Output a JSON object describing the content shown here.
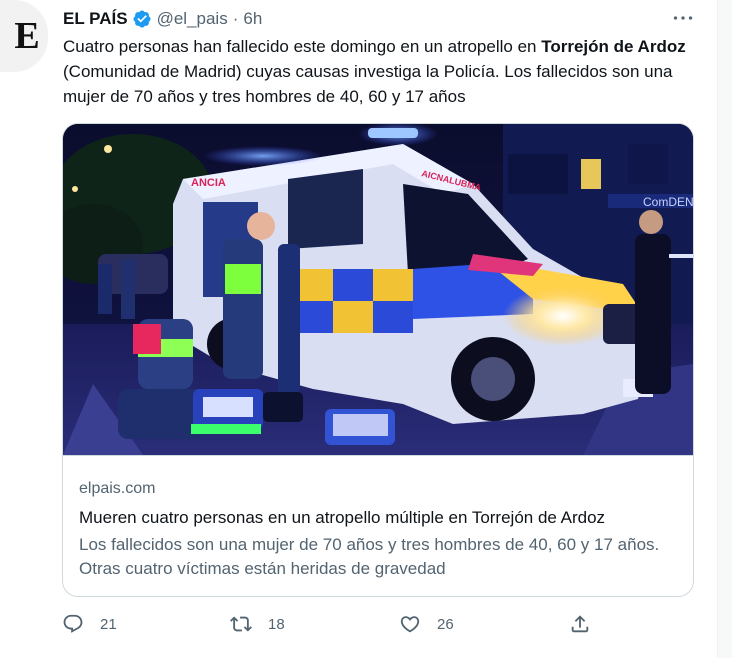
{
  "tweet": {
    "author_name": "EL PAÍS",
    "handle": "@el_pais",
    "separator": "·",
    "time": "6h",
    "avatar_letter": "E",
    "text_before": "Cuatro personas han fallecido este domingo en un atropello en ",
    "text_bold": "Torrejón de Ardoz",
    "text_after": " (Comunidad de Madrid) cuyas causas investiga la Policía. Los fallecidos son una mujer de 70 años y tres hombres de 40, 60 y 17 años"
  },
  "card": {
    "domain": "elpais.com",
    "title": "Mueren cuatro personas en un atropello múltiple en Torrejón de Ardoz",
    "description": "Los fallecidos son una mujer de 70 años y tres hombres de 40, 60 y 17 años. Otras cuatro víctimas están heridas de gravedad",
    "image_text_ambulance_side": "ANCIA",
    "image_text_ambulance_front": "AICNALUBMA",
    "image_text_shop_sign": "ComDENT"
  },
  "actions": {
    "reply_count": "21",
    "retweet_count": "18",
    "like_count": "26",
    "icons": [
      "reply-icon",
      "retweet-icon",
      "like-icon",
      "share-icon"
    ]
  },
  "colors": {
    "verified": "#1d9bf0",
    "secondary_text": "#536471",
    "primary_text": "#0f1419",
    "border": "#cfd9de"
  }
}
